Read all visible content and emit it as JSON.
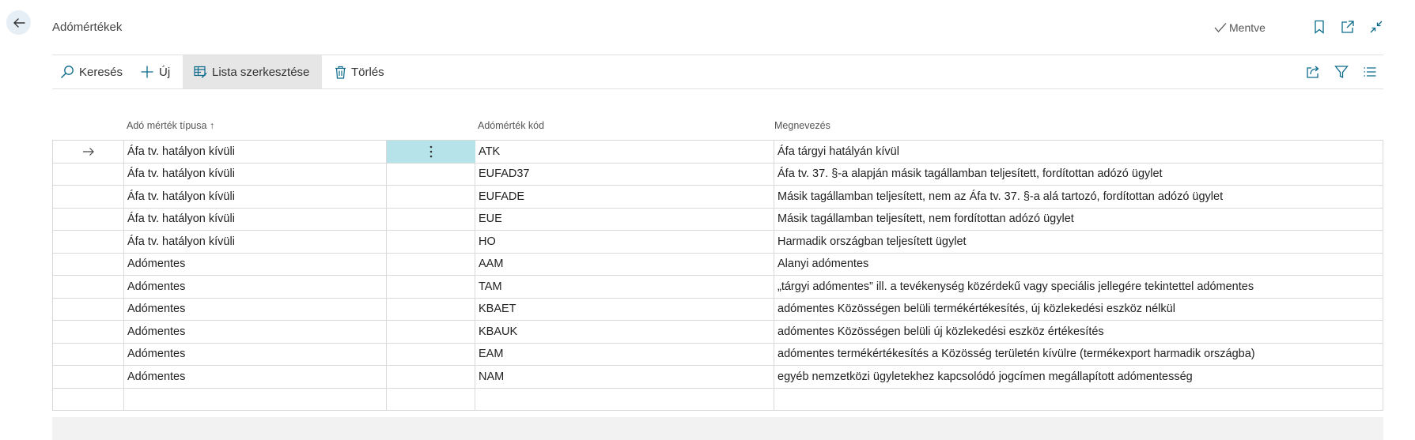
{
  "header": {
    "title": "Adómértékek",
    "saved_label": "Mentve"
  },
  "actions": {
    "search": "Keresés",
    "new": "Új",
    "edit_list": "Lista szerkesztése",
    "delete": "Törlés"
  },
  "columns": {
    "type": "Adó mérték típusa",
    "code": "Adómérték kód",
    "name": "Megnevezés"
  },
  "rows": [
    {
      "type": "Áfa tv. hatályon kívüli",
      "code": "ATK",
      "name": "Áfa tárgyi hatályán kívül"
    },
    {
      "type": "Áfa tv. hatályon kívüli",
      "code": "EUFAD37",
      "name": "Áfa tv. 37. §-a alapján másik tagállamban teljesített, fordítottan adózó ügylet"
    },
    {
      "type": "Áfa tv. hatályon kívüli",
      "code": "EUFADE",
      "name": "Másik tagállamban teljesített, nem az Áfa tv. 37. §-a alá tartozó, fordítottan adózó ügylet"
    },
    {
      "type": "Áfa tv. hatályon kívüli",
      "code": "EUE",
      "name": "Másik tagállamban teljesített, nem fordítottan adózó ügylet"
    },
    {
      "type": "Áfa tv. hatályon kívüli",
      "code": "HO",
      "name": "Harmadik országban teljesített ügylet"
    },
    {
      "type": "Adómentes",
      "code": "AAM",
      "name": "Alanyi adómentes"
    },
    {
      "type": "Adómentes",
      "code": "TAM",
      "name": "„tárgyi adómentes” ill. a tevékenység közérdekű vagy speciális jellegére tekintettel adómentes"
    },
    {
      "type": "Adómentes",
      "code": "KBAET",
      "name": "adómentes Közösségen belüli termékértékesítés, új közlekedési eszköz nélkül"
    },
    {
      "type": "Adómentes",
      "code": "KBAUK",
      "name": "adómentes Közösségen belüli új közlekedési eszköz értékesítés"
    },
    {
      "type": "Adómentes",
      "code": "EAM",
      "name": "adómentes termékértékesítés a Közösség területén kívülre (termékexport harmadik országba)"
    },
    {
      "type": "Adómentes",
      "code": "NAM",
      "name": "egyéb nemzetközi ügyletekhez kapcsolódó jogcímen megállapított adómentesség"
    }
  ],
  "colors": {
    "accent": "#0b6a8c",
    "selected_cell": "#b6e3ea",
    "selected_action": "#e6e6e6"
  }
}
